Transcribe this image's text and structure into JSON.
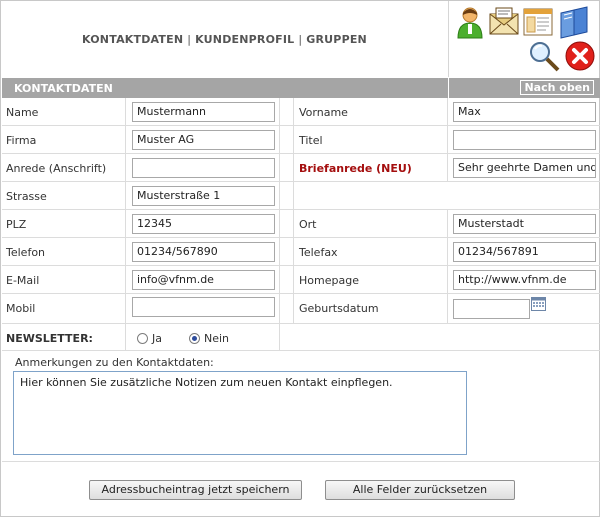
{
  "nav": {
    "kontaktdaten": "KONTAKTDATEN",
    "kundenprofil": "KUNDENPROFIL",
    "gruppen": "GRUPPEN",
    "separator": "|"
  },
  "toolbar_icons": [
    "user-icon",
    "mail-icon",
    "window-icon",
    "book-icon",
    "search-icon",
    "close-icon"
  ],
  "section": {
    "title": "KONTAKTDATEN",
    "top_link": "Nach oben"
  },
  "form": {
    "name": {
      "label": "Name",
      "value": "Mustermann"
    },
    "vorname": {
      "label": "Vorname",
      "value": "Max"
    },
    "firma": {
      "label": "Firma",
      "value": "Muster AG"
    },
    "titel": {
      "label": "Titel",
      "value": ""
    },
    "anrede": {
      "label": "Anrede (Anschrift)",
      "value": ""
    },
    "briefanrede": {
      "label": "Briefanrede (NEU)",
      "value": "Sehr geehrte Damen und Herren"
    },
    "strasse": {
      "label": "Strasse",
      "value": "Musterstraße 1"
    },
    "plz": {
      "label": "PLZ",
      "value": "12345"
    },
    "ort": {
      "label": "Ort",
      "value": "Musterstadt"
    },
    "telefon": {
      "label": "Telefon",
      "value": "01234/567890"
    },
    "telefax": {
      "label": "Telefax",
      "value": "01234/567891"
    },
    "email": {
      "label": "E-Mail",
      "value": "info@vfnm.de"
    },
    "homepage": {
      "label": "Homepage",
      "value": "http://www.vfnm.de"
    },
    "mobil": {
      "label": "Mobil",
      "value": ""
    },
    "geburtsdatum": {
      "label": "Geburtsdatum",
      "value": ""
    },
    "newsletter": {
      "label": "NEWSLETTER:",
      "option_yes": "Ja",
      "option_no": "Nein",
      "selected": "Nein"
    }
  },
  "notes": {
    "label": "Anmerkungen zu den Kontaktdaten:",
    "value": "Hier können Sie zusätzliche Notizen zum neuen Kontakt einpflegen."
  },
  "buttons": {
    "save": "Adressbucheintrag jetzt speichern",
    "reset": "Alle Felder zurücksetzen"
  },
  "colors": {
    "bar": "#a5a5a5",
    "accent_red": "#a40e0e",
    "border": "#dcdcdc"
  }
}
